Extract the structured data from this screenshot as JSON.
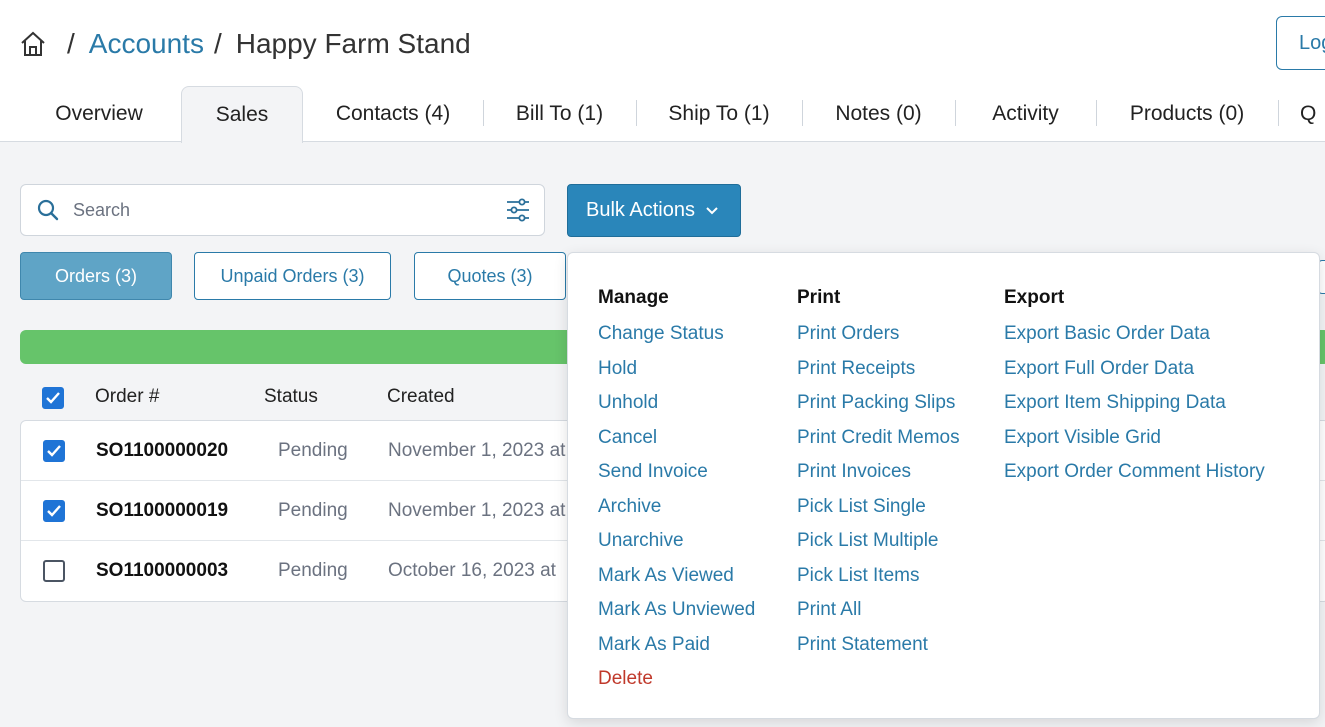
{
  "breadcrumb": {
    "home_icon": "home-icon",
    "accounts_label": "Accounts",
    "separator": "/",
    "current": "Happy Farm Stand"
  },
  "header": {
    "logout_label": "Logout"
  },
  "tabs": [
    {
      "label": "Overview"
    },
    {
      "label": "Sales"
    },
    {
      "label": "Contacts (4)"
    },
    {
      "label": "Bill To (1)"
    },
    {
      "label": "Ship To (1)"
    },
    {
      "label": "Notes (0)"
    },
    {
      "label": "Activity"
    },
    {
      "label": "Products (0)"
    },
    {
      "label": "Q"
    }
  ],
  "search": {
    "placeholder": "Search"
  },
  "bulk_actions": {
    "label": "Bulk Actions"
  },
  "filters": [
    {
      "label": "Orders (3)"
    },
    {
      "label": "Unpaid Orders (3)"
    },
    {
      "label": "Quotes (3)"
    }
  ],
  "grid": {
    "columns": {
      "order": "Order #",
      "status": "Status",
      "created": "Created"
    },
    "rows": [
      {
        "order": "SO1100000020",
        "status": "Pending",
        "created": "November 1, 2023 at",
        "checked": true
      },
      {
        "order": "SO1100000019",
        "status": "Pending",
        "created": "November 1, 2023 at",
        "checked": true
      },
      {
        "order": "SO1100000003",
        "status": "Pending",
        "created": "October 16, 2023 at",
        "checked": false
      }
    ]
  },
  "menu": {
    "manage": {
      "title": "Manage",
      "items": [
        "Change Status",
        "Hold",
        "Unhold",
        "Cancel",
        "Send Invoice",
        "Archive",
        "Unarchive",
        "Mark As Viewed",
        "Mark As Unviewed",
        "Mark As Paid",
        "Delete"
      ]
    },
    "print": {
      "title": "Print",
      "items": [
        "Print Orders",
        "Print Receipts",
        "Print Packing Slips",
        "Print Credit Memos",
        "Print Invoices",
        "Pick List Single",
        "Pick List Multiple",
        "Pick List Items",
        "Print All",
        "Print Statement"
      ]
    },
    "export": {
      "title": "Export",
      "items": [
        "Export Basic Order Data",
        "Export Full Order Data",
        "Export Item Shipping Data",
        "Export Visible Grid",
        "Export Order Comment History"
      ]
    }
  },
  "colors": {
    "accent": "#2a7aa8",
    "primary_button": "#2a86ba",
    "progress": "#66c46a",
    "danger": "#c0392b",
    "checkbox": "#1f74d6"
  }
}
